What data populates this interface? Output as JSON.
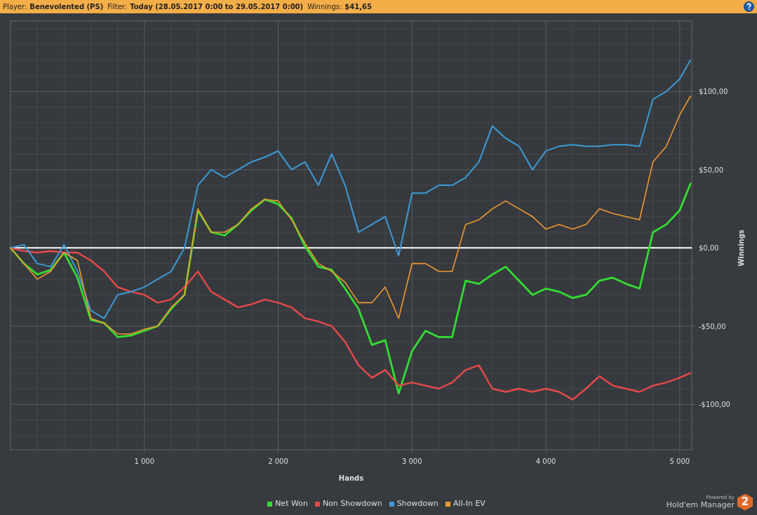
{
  "header": {
    "fields": [
      {
        "label": "Player:",
        "value": "Benevolented (PS)"
      },
      {
        "label": "Filter:",
        "value": "Today (28.05.2017 0:00 to 29.05.2017 0:00)"
      },
      {
        "label": "Winnings:",
        "value": "$41,65"
      }
    ]
  },
  "chart": {
    "chart_data": {
      "type": "line",
      "grid": true,
      "xlabel": "Hands",
      "ylabel": "Winnings",
      "xlim": [
        0,
        5090
      ],
      "ylim": [
        -129,
        145
      ],
      "xticks": [
        {
          "value": 1000,
          "label": "1 000"
        },
        {
          "value": 2000,
          "label": "2 000"
        },
        {
          "value": 3000,
          "label": "3 000"
        },
        {
          "value": 4000,
          "label": "4 000"
        },
        {
          "value": 5000,
          "label": "5 000"
        }
      ],
      "yticks": [
        {
          "value": 100,
          "label": "$100,00"
        },
        {
          "value": 50,
          "label": "$50,00"
        },
        {
          "value": 0,
          "label": "$0,00"
        },
        {
          "value": -50,
          "label": "-$50,00"
        },
        {
          "value": -100,
          "label": "-$100,00"
        }
      ],
      "x": [
        0,
        100,
        200,
        300,
        400,
        500,
        600,
        700,
        800,
        900,
        1000,
        1100,
        1200,
        1300,
        1400,
        1500,
        1600,
        1700,
        1800,
        1900,
        2000,
        2100,
        2200,
        2300,
        2400,
        2500,
        2600,
        2700,
        2800,
        2900,
        3000,
        3100,
        3200,
        3300,
        3400,
        3500,
        3600,
        3700,
        3800,
        3900,
        4000,
        4100,
        4200,
        4300,
        4400,
        4500,
        4600,
        4700,
        4800,
        4900,
        5000,
        5080
      ],
      "series": [
        {
          "name": "Net Won",
          "color": "#33dd33",
          "values": [
            0,
            -10,
            -17,
            -14,
            -3,
            -19,
            -46,
            -48,
            -57,
            -56,
            -53,
            -50,
            -39,
            -30,
            24,
            10,
            8,
            15,
            24,
            31,
            28,
            19,
            1,
            -12,
            -14,
            -26,
            -39,
            -62,
            -59,
            -93,
            -66,
            -53,
            -57,
            -57,
            -21,
            -23,
            -17,
            -12,
            -21,
            -30,
            -26,
            -28,
            -32,
            -30,
            -21,
            -19,
            -23,
            -26,
            10,
            15,
            24,
            41
          ]
        },
        {
          "name": "Non Showdown",
          "color": "#e84848",
          "values": [
            0,
            -2,
            -3,
            -2,
            -3,
            -3,
            -8,
            -15,
            -25,
            -28,
            -30,
            -35,
            -33,
            -25,
            -15,
            -28,
            -33,
            -38,
            -36,
            -33,
            -35,
            -38,
            -45,
            -47,
            -50,
            -60,
            -75,
            -83,
            -78,
            -88,
            -86,
            -88,
            -90,
            -86,
            -78,
            -75,
            -90,
            -92,
            -90,
            -92,
            -90,
            -92,
            -97,
            -90,
            -82,
            -88,
            -90,
            -92,
            -88,
            -86,
            -83,
            -80
          ]
        },
        {
          "name": "Showdown",
          "color": "#3c9ad8",
          "values": [
            0,
            2,
            -10,
            -12,
            2,
            -15,
            -40,
            -45,
            -30,
            -28,
            -25,
            -20,
            -15,
            0,
            40,
            50,
            45,
            50,
            55,
            58,
            62,
            50,
            55,
            40,
            60,
            40,
            10,
            15,
            20,
            -5,
            35,
            35,
            40,
            40,
            45,
            55,
            78,
            70,
            65,
            50,
            62,
            65,
            66,
            65,
            65,
            66,
            66,
            65,
            95,
            100,
            108,
            120
          ]
        },
        {
          "name": "All-In EV",
          "color": "#f0982e",
          "values": [
            0,
            -10,
            -20,
            -15,
            -3,
            -8,
            -45,
            -48,
            -55,
            -55,
            -52,
            -50,
            -38,
            -30,
            25,
            10,
            10,
            15,
            25,
            31,
            30,
            18,
            3,
            -10,
            -15,
            -22,
            -35,
            -35,
            -25,
            -45,
            -10,
            -10,
            -15,
            -15,
            15,
            18,
            25,
            30,
            25,
            20,
            12,
            15,
            12,
            15,
            25,
            22,
            20,
            18,
            55,
            65,
            85,
            97
          ]
        }
      ]
    }
  },
  "branding": {
    "powered_by": "Powered by",
    "product": "Hold'em Manager",
    "logo_text": "2"
  }
}
